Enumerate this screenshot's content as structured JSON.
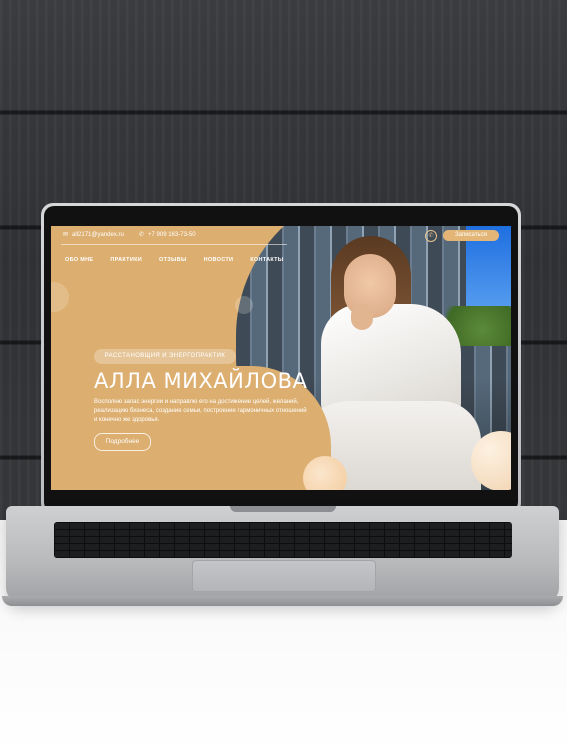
{
  "site": {
    "email": "all2171@yandex.ru",
    "phone": "+7 909 163-73-50",
    "book_button": "Записаться",
    "nav": [
      "ОБО МНЕ",
      "ПРАКТИКИ",
      "ОТЗЫВЫ",
      "НОВОСТИ",
      "КОНТАКТЫ"
    ],
    "tagline": "РАССТАНОВЩИЯ И ЭНЕРГОПРАКТИК",
    "name": "АЛЛА МИХАЙЛОВА",
    "description": "Восполню запас энергии и направлю его на достижение целей, желаний, реализацию бизнеса, создание семьи, построение гармоничных отношений и конечно же здоровья.",
    "more_button": "Подробнее"
  },
  "colors": {
    "accent_gold": "#dcae6f",
    "button_gold": "#e3b678",
    "text_white": "#ffffff"
  },
  "icons": {
    "email": "mail-icon",
    "phone": "phone-icon",
    "messenger": "whatsapp-icon"
  }
}
